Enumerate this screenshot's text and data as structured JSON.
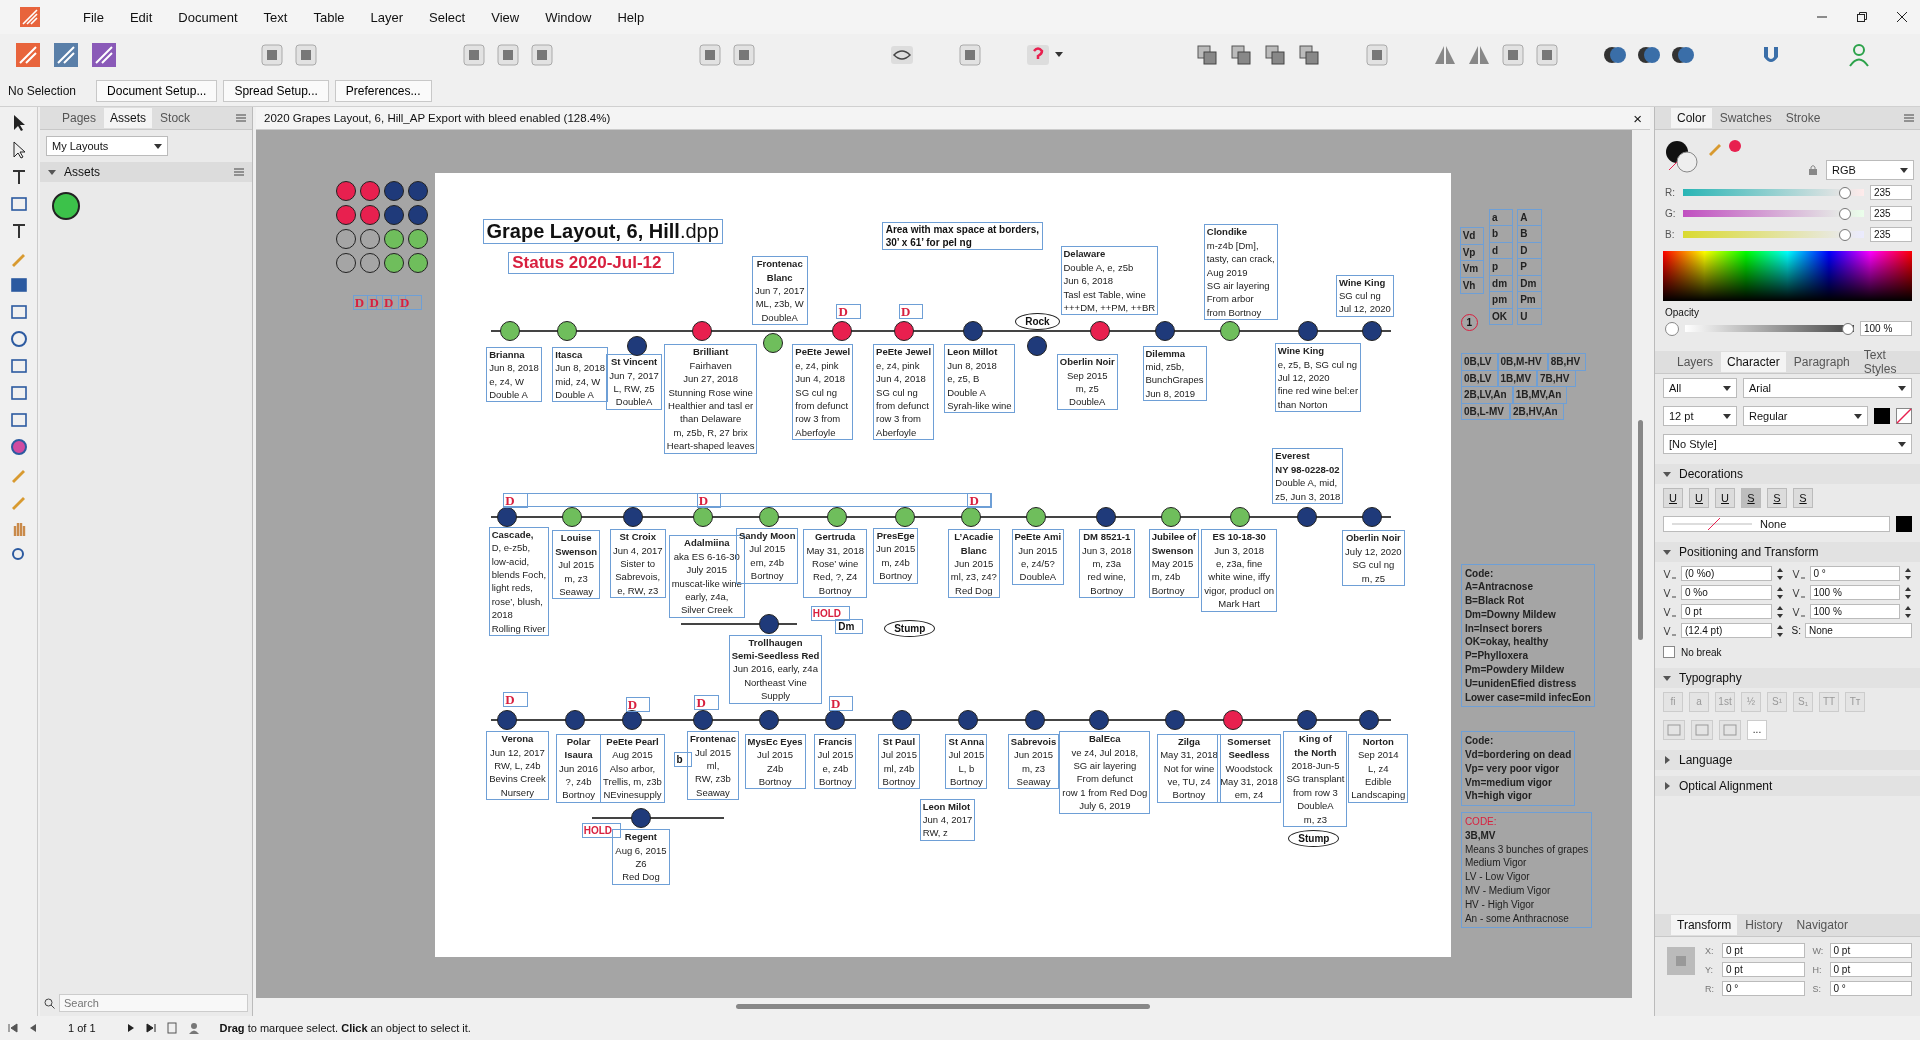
{
  "menu": [
    "File",
    "Edit",
    "Document",
    "Text",
    "Table",
    "Layer",
    "Select",
    "View",
    "Window",
    "Help"
  ],
  "context_bar": {
    "selection": "No Selection",
    "buttons": [
      "Document Setup...",
      "Spread Setup...",
      "Preferences..."
    ]
  },
  "left_panel": {
    "tabs": [
      {
        "label": "Pages",
        "selected": false
      },
      {
        "label": "Assets",
        "selected": true
      },
      {
        "label": "Stock",
        "selected": false
      }
    ],
    "category": "My Layouts",
    "section": "Assets",
    "section_expanded": true,
    "assets": [
      {
        "color": "#3cc24a"
      }
    ],
    "search": {
      "placeholder": "Search"
    }
  },
  "document_tab": {
    "title": "2020 Grapes Layout, 6, Hill_AP Export with bleed enabled (128.4%)",
    "close": "×"
  },
  "canvas": {
    "swatches": [
      {
        "color": "#e8204f"
      },
      {
        "color": "#e8204f"
      },
      {
        "color": "#1f3a7a"
      },
      {
        "color": "#1f3a7a"
      },
      {
        "color": "#e8204f"
      },
      {
        "color": "#e8204f"
      },
      {
        "color": "#1f3a7a"
      },
      {
        "color": "#1f3a7a"
      },
      {
        "color": "#a5a5a5"
      },
      {
        "color": "#a5a5a5"
      },
      {
        "color": "#6fbe5c"
      },
      {
        "color": "#6fbe5c"
      },
      {
        "color": "#a5a5a5"
      },
      {
        "color": "#a5a5a5"
      },
      {
        "color": "#6fbe5c"
      },
      {
        "color": "#6fbe5c"
      }
    ],
    "title": "**Grape Layout, 6, Hill**.dpp",
    "status": "Status 2020-Jul-12",
    "note": [
      "Area with max space at borders,",
      "30’ x 61’ for pel  ng"
    ],
    "dots": [
      {
        "color": "#6fbe5c"
      },
      {
        "color": "#6fbe5c"
      },
      {
        "color": "#1f3a7a"
      },
      {
        "color": "#e8204f"
      },
      {
        "color": "#6fbe5c"
      },
      {
        "color": "#e8204f"
      },
      {
        "color": "#e8204f"
      },
      {
        "color": "#1f3a7a"
      },
      {
        "color": "#1f3a7a"
      },
      {
        "color": "#e8204f"
      },
      {
        "color": "#1f3a7a"
      },
      {
        "color": "#6fbe5c"
      },
      {
        "color": "#1f3a7a"
      },
      {
        "color": "#1f3a7a"
      },
      {
        "color": "#1f3a7a"
      },
      {
        "color": "#6fbe5c"
      },
      {
        "color": "#1f3a7a"
      },
      {
        "color": "#6fbe5c"
      },
      {
        "color": "#6fbe5c"
      },
      {
        "color": "#6fbe5c"
      },
      {
        "color": "#6fbe5c"
      },
      {
        "color": "#6fbe5c"
      },
      {
        "color": "#6fbe5c"
      },
      {
        "color": "#1f3a7a"
      },
      {
        "color": "#6fbe5c"
      },
      {
        "color": "#6fbe5c"
      },
      {
        "color": "#1f3a7a"
      },
      {
        "color": "#1f3a7a"
      },
      {
        "color": "#1f3a7a"
      },
      {
        "color": "#1f3a7a"
      },
      {
        "color": "#1f3a7a"
      },
      {
        "color": "#1f3a7a"
      },
      {
        "color": "#1f3a7a"
      },
      {
        "color": "#1f3a7a"
      },
      {
        "color": "#1f3a7a"
      },
      {
        "color": "#1f3a7a"
      },
      {
        "color": "#1f3a7a"
      },
      {
        "color": "#1f3a7a"
      },
      {
        "color": "#1f3a7a"
      },
      {
        "color": "#e8204f"
      },
      {
        "color": "#1f3a7a"
      },
      {
        "color": "#1f3a7a"
      },
      {
        "color": "#1f3a7a"
      },
      {
        "color": "#1f3a7a"
      }
    ],
    "labels": [
      {
        "name": [
          "Brianna"
        ],
        "lines": [
          "Jun 8, 2018",
          "e, z4, W",
          "Double A"
        ]
      },
      {
        "name": [
          "Itasca"
        ],
        "lines": [
          "Jun 8, 2018",
          "mid, z4, W",
          "Double A"
        ]
      },
      {
        "name": [
          "St Vincent"
        ],
        "lines": [
          "Jun 7, 2017",
          "L, RW, z5",
          "DoubleA"
        ]
      },
      {
        "name": [
          "Brilliant"
        ],
        "lines": [
          "Fairhaven",
          "Jun 27, 2018",
          "Stunning Rose wine",
          "Healthier and tasl er",
          "than Delaware",
          "m, z5b, R, 27 brix",
          "Heart-shaped leaves"
        ]
      },
      {
        "name": [
          "Frontenac",
          "Blanc"
        ],
        "lines": [
          "Jun 7, 2017",
          "ML, z3b, W",
          "DoubleA"
        ]
      },
      {
        "name": [
          "PeEte Jewel"
        ],
        "lines": [
          "e, z4, pink",
          "Jun 4, 2018",
          "SG cul  ng",
          "from defunct",
          "row 3 from",
          "Aberfoyle"
        ]
      },
      {
        "name": [
          "PeEte Jewel"
        ],
        "lines": [
          "e, z4, pink",
          "Jun 4, 2018",
          "SG cul  ng",
          "from defunct",
          "row 3 from",
          "Aberfoyle"
        ]
      },
      {
        "name": [
          "Leon Millot"
        ],
        "lines": [
          "Jun 8, 2018",
          "e, z5, B",
          "Double A",
          "Syrah-like wine"
        ]
      },
      {
        "name": [
          "Delaware"
        ],
        "lines": [
          "Double A, e, z5b",
          "Jun 6, 2018",
          "Tasl est Table, wine",
          "+++DM, ++PM, ++BR"
        ]
      },
      {
        "name": [
          "Oberlin Noir"
        ],
        "lines": [
          "Sep 2015",
          "m, z5",
          "DoubleA"
        ]
      },
      {
        "name": [
          "Dilemma"
        ],
        "lines": [
          "mid, z5b,",
          "BunchGrapes",
          "Jun 8, 2019"
        ]
      },
      {
        "name": [
          "Clondike"
        ],
        "lines": [
          "m-z4b [Dm],",
          "tasty, can crack,",
          "Aug 2019",
          "SG air layering",
          "From arbor",
          "from Bortnoy"
        ]
      },
      {
        "name": [
          "Wine King"
        ],
        "lines": [
          "e, z5, B, SG cul  ng",
          "Jul 12, 2020",
          "fine red wine bel:er",
          "than Norton"
        ]
      },
      {
        "name": [
          "Wine King"
        ],
        "lines": [
          "SG cul  ng",
          "Jul 12, 2020"
        ]
      },
      {
        "name": [
          "Everest",
          "NY 98-0228-02"
        ],
        "lines": [
          "Double A, mid,",
          "z5, Jun 3, 2018"
        ]
      },
      {
        "name": [
          "Cascade,"
        ],
        "lines": [
          "D, e-z5b,",
          "low-acid,",
          "blends Foch,",
          "light reds,",
          "rose’, blush,",
          "2018",
          "Rolling River"
        ]
      },
      {
        "name": [
          "Louise",
          "Swenson"
        ],
        "lines": [
          "Jul 2015",
          "m, z3",
          "Seaway"
        ]
      },
      {
        "name": [
          "St Croix"
        ],
        "lines": [
          "Jun 4, 2017",
          "Sister to",
          "Sabrevois,",
          "e, RW, z3"
        ]
      },
      {
        "name": [
          "Adalmiina"
        ],
        "lines": [
          "aka ES 6-16-30",
          "July 2015",
          "muscat-like wine",
          "early, z4a,",
          "Silver Creek"
        ]
      },
      {
        "name": [
          "Sandy Moon"
        ],
        "lines": [
          "Jul 2015",
          "em, z4b",
          "Bortnoy"
        ]
      },
      {
        "name": [
          "Gertruda"
        ],
        "lines": [
          "May 31, 2018",
          "Rose’ wine",
          "Red, ?, Z4",
          "Bortnoy"
        ]
      },
      {
        "name": [
          "PresEge"
        ],
        "lines": [
          "Jun 2015",
          "m, z4b",
          "Bortnoy"
        ]
      },
      {
        "name": [
          "L’Acadie",
          "Blanc"
        ],
        "lines": [
          "Jun 2015",
          "ml, z3, z4?",
          "Red Dog"
        ]
      },
      {
        "name": [
          "PeEte Ami"
        ],
        "lines": [
          "Jun 2015",
          "e, z4/5?",
          "DoubleA"
        ]
      },
      {
        "name": [
          "DM 8521-1"
        ],
        "lines": [
          "Jun 3, 2018",
          "m, z3a",
          "red wine,",
          "Bortnoy"
        ]
      },
      {
        "name": [
          "Jubilee of",
          "Swenson"
        ],
        "lines": [
          "May 2015",
          "m, z4b",
          "Bortnoy"
        ]
      },
      {
        "name": [
          "ES 10-18-30"
        ],
        "lines": [
          "Jun 3, 2018",
          "e, z3a, fine",
          "white wine, iffy",
          "vigor, producl on",
          "Mark Hart"
        ]
      },
      {
        "name": [
          "Oberlin Noir"
        ],
        "lines": [
          "July 12, 2020",
          "SG cul  ng",
          "m, z5"
        ]
      },
      {
        "name": [
          "Trollhaugen",
          "Semi-Seedless Red"
        ],
        "lines": [
          "Jun 2016, early, z4a",
          "Northeast Vine",
          "Supply"
        ]
      },
      {
        "name": [
          "Verona"
        ],
        "lines": [
          "Jun 12, 2017",
          "RW, L, z4b",
          "Bevins Creek",
          "Nursery"
        ]
      },
      {
        "name": [
          "Polar",
          "Isaura"
        ],
        "lines": [
          "Jun 2016",
          "?, z4b",
          "Bortnoy"
        ]
      },
      {
        "name": [
          "PeEte Pearl"
        ],
        "lines": [
          "Aug 2015",
          "Also arbor,",
          "Trellis, m, z3b",
          "NEvinesupply"
        ]
      },
      {
        "name": [
          "Frontenac"
        ],
        "lines": [
          "Jul 2015",
          "ml,",
          "RW, z3b",
          "Seaway"
        ]
      },
      {
        "name": [
          "MysEc Eyes"
        ],
        "lines": [
          "Jul 2015",
          "Z4b",
          "Bortnoy"
        ]
      },
      {
        "name": [
          "Francis"
        ],
        "lines": [
          "Jul 2015",
          "e, z4b",
          "Bortnoy"
        ]
      },
      {
        "name": [
          "St Paul"
        ],
        "lines": [
          "Jul 2015",
          "ml, z4b",
          "Bortnoy"
        ]
      },
      {
        "name": [
          "St Anna"
        ],
        "lines": [
          "Jul 2015",
          "L, b",
          "Bortnoy"
        ]
      },
      {
        "name": [
          "Sabrevois"
        ],
        "lines": [
          "Jun 2015",
          "m, z3",
          "Seaway"
        ]
      },
      {
        "name": [
          "BalEca"
        ],
        "lines": [
          "ve z4, Jul 2018,",
          "SG air layering",
          "From defunct",
          "row 1 from Red Dog",
          "July 6, 2019"
        ]
      },
      {
        "name": [
          "Zilga"
        ],
        "lines": [
          "May 31, 2018",
          "Not for wine",
          "ve, TU, z4",
          "Bortnoy"
        ]
      },
      {
        "name": [
          "Somerset",
          "Seedless"
        ],
        "lines": [
          "Woodstock",
          "May 31, 2018",
          "em, z4"
        ]
      },
      {
        "name": [
          "King of",
          "the North"
        ],
        "lines": [
          "2018-Jun-5",
          "SG transplant",
          "from row 3",
          "DoubleA",
          "m, z3"
        ]
      },
      {
        "name": [
          "Norton"
        ],
        "lines": [
          "Sep 2014",
          "L, z4",
          "Edible",
          "Landscaping"
        ]
      },
      {
        "name": [
          "Leon Milot"
        ],
        "lines": [
          "Jun 4, 2017",
          "RW, z"
        ]
      },
      {
        "name": [
          "Regent"
        ],
        "lines": [
          "Aug 6, 2015",
          "Z6",
          "Red Dog"
        ]
      }
    ],
    "d_marks": [
      "D",
      "D",
      "D",
      "D",
      "D",
      "D",
      "D",
      "D",
      "D",
      "D",
      "D",
      "D",
      "D"
    ],
    "tags": [
      {
        "kind": "ellipse",
        "text": "Rock"
      },
      {
        "kind": "hold",
        "text": "HOLD"
      },
      {
        "kind": "box",
        "text": "Dm"
      },
      {
        "kind": "ellipse",
        "text": "Stump"
      },
      {
        "kind": "box",
        "text": "b"
      },
      {
        "kind": "ellipse",
        "text": "Stump"
      },
      {
        "kind": "hold",
        "text": "HOLD"
      }
    ],
    "side_notes": {
      "vigor": [
        "Vd",
        "Vp",
        "Vm",
        "Vh"
      ],
      "lower": [
        "a",
        "b",
        "d",
        "p",
        "dm",
        "pm",
        "OK"
      ],
      "upper": [
        "A",
        "B",
        "D",
        "P",
        "Dm",
        "Pm",
        "U"
      ],
      "marker": "1",
      "combos": [
        [
          "0B,LV",
          "0B,M-HV",
          "8B,HV"
        ],
        [
          "0B,LV",
          "1B,MV",
          "7B,HV"
        ],
        [
          "2B,LV,An",
          "1B,MV,An"
        ],
        [
          "0B,L-MV",
          "2B,HV,An"
        ]
      ],
      "legends": [
        {
          "kind": "bold",
          "title": "Code:",
          "lines": [
            "A=Antracnose",
            "B=Black Rot",
            "Dm=Downy Mildew",
            "In=Insect borers",
            "OK=okay, healthy",
            "P=Phylloxera",
            "Pm=Powdery Mildew",
            "U=unidenEfied distress",
            "Lower case=mild infecEon"
          ]
        },
        {
          "kind": "bold",
          "title": "Code:",
          "lines": [
            "Vd=bordering on dead",
            "Vp= very poor vigor",
            "Vm=medium vigor",
            "Vh=high vigor"
          ]
        },
        {
          "kind": "plain",
          "title": "CODE:",
          "lines": [
            "**3B,MV**",
            "Means 3 bunches of grapes",
            "Medium Vigor",
            "LV - Low Vigor",
            "MV - Medium Vigor",
            "HV - High Vigor",
            "An - some Anthracnose"
          ]
        }
      ]
    }
  },
  "right_panel": {
    "color_tabs": [
      {
        "label": "Color",
        "selected": true
      },
      {
        "label": "Swatches",
        "selected": false
      },
      {
        "label": "Stroke",
        "selected": false
      }
    ],
    "mode": "RGB",
    "channels": [
      {
        "name": "R:",
        "level": 0.92,
        "value": "235"
      },
      {
        "name": "G:",
        "level": 0.92,
        "value": "235"
      },
      {
        "name": "B:",
        "level": 0.92,
        "value": "235"
      }
    ],
    "opacity": {
      "label": "Opacity",
      "level": 1,
      "value": "100 %"
    },
    "text_tabs": [
      {
        "label": "Layers",
        "selected": false
      },
      {
        "label": "Character",
        "selected": true
      },
      {
        "label": "Paragraph",
        "selected": false
      },
      {
        "label": "Text Styles",
        "selected": false
      }
    ],
    "filter": "All",
    "font": "Arial",
    "size": "12 pt",
    "weight": "Regular",
    "style": "[No Style]",
    "sections": [
      {
        "title": "Decorations",
        "expanded": true
      },
      {
        "title": "Positioning and Transform",
        "expanded": true
      },
      {
        "title": "Typography",
        "expanded": true
      },
      {
        "title": "Language",
        "expanded": false
      },
      {
        "title": "Optical Alignment",
        "expanded": false
      }
    ],
    "decoration_buttons": [
      "U",
      "U",
      "U",
      "S",
      "S",
      "S"
    ],
    "line_style": "None",
    "positioning": [
      {
        "value": "(0 %o)"
      },
      {
        "value": "0 °"
      },
      {
        "value": "0 %o"
      },
      {
        "value": "100 %"
      },
      {
        "value": "0 pt"
      },
      {
        "value": "100 %"
      },
      {
        "value": "(12.4 pt)"
      }
    ],
    "shear_label": "S:",
    "shear_value": "None",
    "no_break": {
      "label": "No break",
      "checked": false
    },
    "typography_buttons": [
      "fi",
      "a",
      "1st",
      "½",
      "S¹",
      "S₁",
      "TT",
      "Tт"
    ],
    "more": "...",
    "transform_tabs": [
      {
        "label": "Transform",
        "selected": true
      },
      {
        "label": "History",
        "selected": false
      },
      {
        "label": "Navigator",
        "selected": false
      }
    ],
    "transform_fields": [
      {
        "label": "X:",
        "value": "0 pt"
      },
      {
        "label": "W:",
        "value": "0 pt"
      },
      {
        "label": "Y:",
        "value": "0 pt"
      },
      {
        "label": "H:",
        "value": "0 pt"
      },
      {
        "label": "R:",
        "value": "0 °"
      },
      {
        "label": "S:",
        "value": "0 °"
      }
    ]
  },
  "status_bar": {
    "page": "1 of 1",
    "hint": "**Drag** to marquee select. **Click** an object to select it."
  }
}
